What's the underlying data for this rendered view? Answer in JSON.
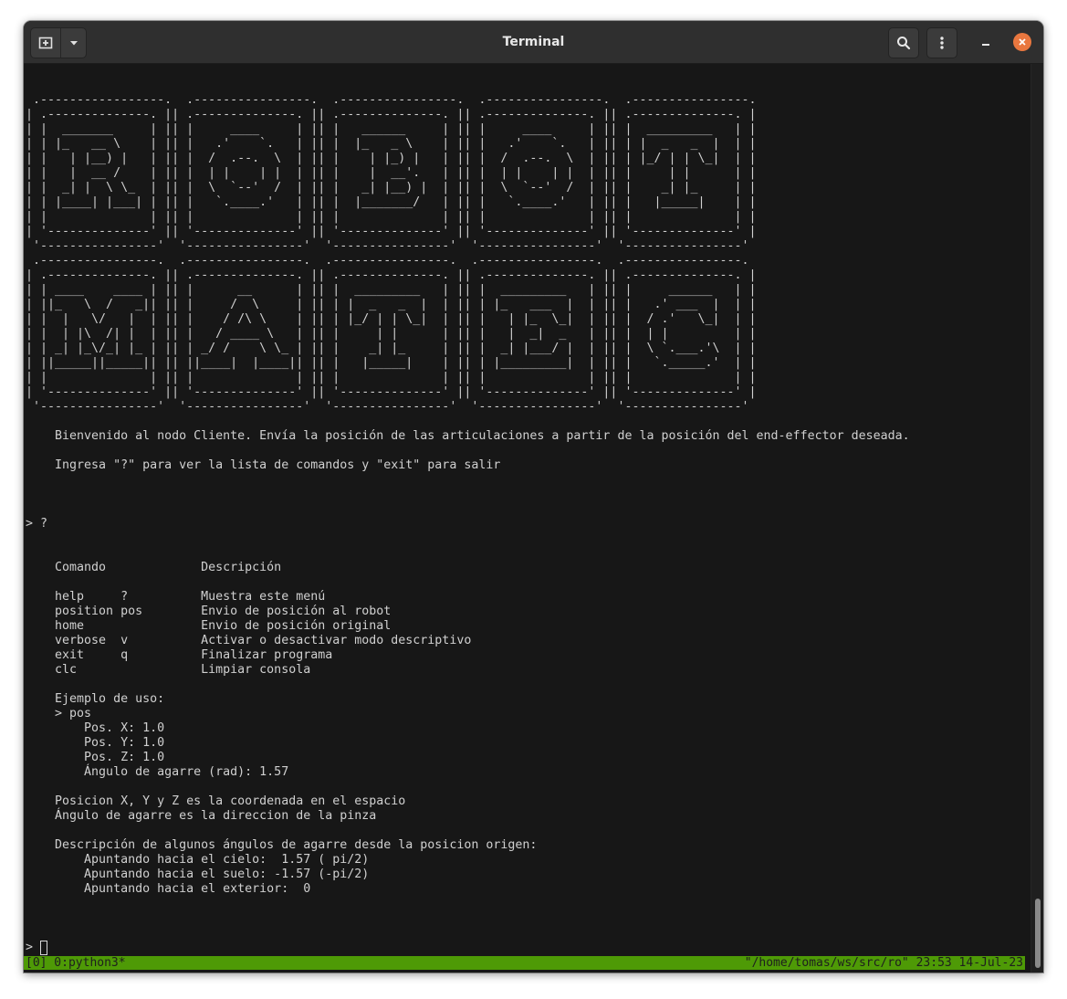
{
  "window": {
    "title": "Terminal"
  },
  "titlebar": {
    "new_tab_icon": "new-tab-icon",
    "menu_dropdown_icon": "chevron-down-icon",
    "search_icon": "search-icon",
    "hamburger_icon": "kebab-menu-icon",
    "minimize_icon": "minimize-icon",
    "close_icon": "close-icon",
    "close_color": "#e9773f"
  },
  "terminal": {
    "output": " .-----------------.  .----------------.  .----------------.  .----------------.  .----------------.\n| .--------------. || .--------------. || .--------------. || .--------------. || .--------------. |\n| |  _______     | || |     ____     | || |   ______     | || |     ____     | || |  _________   | |\n| | |_   __ \\    | || |   .'    `.   | || |  |_   _ \\    | || |   .'    `.   | || | |  _   _  |  | |\n| |   | |__) |   | || |  /  .--.  \\  | || |    | |_) |   | || |  /  .--.  \\  | || | |_/ | | \\_|  | |\n| |   |  __ /    | || |  | |    | |  | || |    |  __'.   | || |  | |    | |  | || |     | |      | |\n| |  _| |  \\ \\_  | || |  \\  `--'  /  | || |   _| |__) |  | || |  \\  `--'  /  | || |    _| |_     | |\n| | |____| |___| | || |   `.____.'   | || |  |_______/   | || |   `.____.'   | || |   |_____|    | |\n| |              | || |              | || |              | || |              | || |              | |\n| '--------------' || '--------------' || '--------------' || '--------------' || '--------------' |\n '----------------'  '----------------'  '----------------'  '----------------'  '----------------'\n .----------------.  .----------------.  .----------------.  .----------------.  .----------------.\n| .--------------. || .--------------. || .--------------. || .--------------. || .--------------. |\n| | ____    ____ | || |      __      | || |  _________   | || |  _________   | || |     ______   | |\n| ||_   \\  /   _|| || |     /  \\     | || | |  _   _  |  | || | |_   ___  |  | || |   .' ___  |  | |\n| |  |   \\/   |  | || |    / /\\ \\    | || | |_/ | | \\_|  | || |   | |_  \\_|  | || |  / .'   \\_|  | |\n| |  | |\\  /| |  | || |   / ____ \\   | || |     | |      | || |   |  _|  _   | || |  | |         | |\n| | _| |_\\/_| |_ | || | _/ /    \\ \\_ | || |    _| |_     | || |  _| |___/ |  | || |  \\ `.___.'\\  | |\n| ||_____||_____|| || ||____|  |____|| || |   |_____|    | || | |_________|  | || |   `._____.'  | |\n| |              | || |              | || |              | || |              | || |              | |\n| '--------------' || '--------------' || '--------------' || '--------------' || '--------------' |\n '----------------'  '----------------'  '----------------'  '----------------'  '----------------'\n\n    Bienvenido al nodo Cliente. Envía la posición de las articulaciones a partir de la posición del end-effector deseada.\n\n    Ingresa \"?\" para ver la lista de comandos y \"exit\" para salir\n\n\n\n> ?\n\n\n    Comando             Descripción\n\n    help     ?          Muestra este menú\n    position pos        Envio de posición al robot\n    home                Envio de posición original\n    verbose  v          Activar o desactivar modo descriptivo\n    exit     q          Finalizar programa\n    clc                 Limpiar consola\n\n    Ejemplo de uso:\n    > pos\n        Pos. X: 1.0\n        Pos. Y: 1.0\n        Pos. Z: 1.0\n        Ángulo de agarre (rad): 1.57\n\n    Posicion X, Y y Z es la coordenada en el espacio\n    Ángulo de agarre es la direccion de la pinza\n\n    Descripción de algunos ángulos de agarre desde la posicion origen:\n        Apuntando hacia el cielo:  1.57 ( pi/2)\n        Apuntando hacia el suelo: -1.57 (-pi/2)\n        Apuntando hacia el exterior:  0",
    "prompt": "> "
  },
  "tmux_status": {
    "left": "[0] 0:python3*",
    "right": "\"/home/tomas/ws/src/ro\" 23:53 14-Jul-23",
    "color": "#4e9a06"
  }
}
